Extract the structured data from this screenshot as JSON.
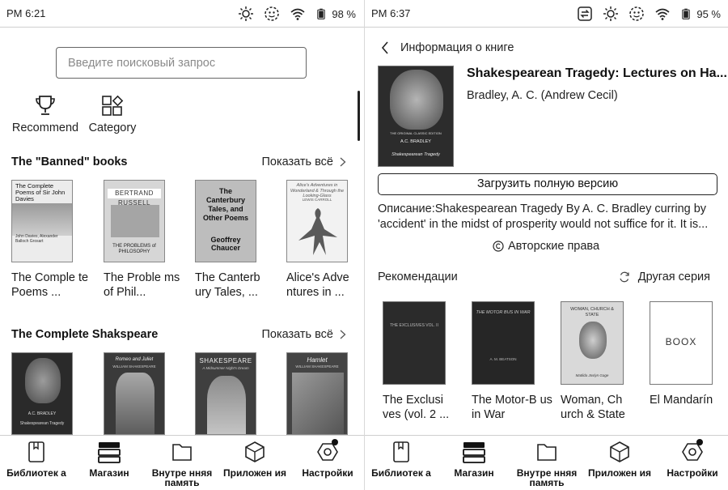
{
  "left": {
    "status": {
      "time": "PM  6:21",
      "battery": "98 %"
    },
    "search": {
      "placeholder": "Введите поисковый запрос"
    },
    "categories": [
      {
        "label": "Recommend",
        "icon": "trophy-icon"
      },
      {
        "label": "Category",
        "icon": "category-grid-icon"
      }
    ],
    "sections": [
      {
        "title": "The \"Banned\" books",
        "show_all": "Показать всё",
        "books": [
          {
            "title": "The Comple te Poems ...",
            "cover_text": "The Complete Poems of Sir John Davies",
            "cover_sub": "John Davies, Alexander Balloch Grosart"
          },
          {
            "title": "The Proble ms of Phil...",
            "cover_text": "BERTRAND RUSSELL",
            "cover_sub": "THE PROBLEMS of PHILOSOPHY"
          },
          {
            "title": "The Canterb ury Tales, ...",
            "cover_text": "The Canterbury Tales, and Other Poems",
            "cover_sub": "Geoffrey Chaucer"
          },
          {
            "title": "Alice's Adve ntures in ...",
            "cover_text": "Alice's Adventures in Wonderland & Through the Looking-Glass",
            "cover_sub": "LEWIS CARROLL"
          }
        ]
      },
      {
        "title": "The Complete Shakspeare",
        "show_all": "Показать всё",
        "books": [
          {
            "title": "",
            "cover_text": "A.C. BRADLEY",
            "cover_sub": "Shakespearean Tragedy"
          },
          {
            "title": "",
            "cover_text": "Romeo and Juliet",
            "cover_sub": "WILLIAM SHAKESPEARE"
          },
          {
            "title": "",
            "cover_text": "SHAKESPEARE",
            "cover_sub": "A Midsummer Night's Dream"
          },
          {
            "title": "",
            "cover_text": "Hamlet",
            "cover_sub": "WILLIAM SHAKESPEARE"
          }
        ]
      }
    ]
  },
  "right": {
    "status": {
      "time": "PM  6:37",
      "battery": "95 %"
    },
    "header": {
      "back_title": "Информация о книге"
    },
    "book": {
      "title": "Shakespearean Tragedy: Lectures on Ha...",
      "author": "Bradley, A. C. (Andrew Cecil)",
      "cover_top": "THE ORIGINAL CLASSIC EDITION",
      "cover_name": "A.C. BRADLEY",
      "cover_sub": "Shakespearean Tragedy"
    },
    "download_label": "Загрузить полную версию",
    "description": "Описание:Shakespearean Tragedy By A. C. Bradley curring by 'accident' in the midst of prosperity would not suffice for it. It is...",
    "copyright_label": "Авторские права",
    "recommendations": {
      "title": "Рекомендации",
      "other_series": "Другая серия",
      "books": [
        {
          "title": "The Exclusi ves (vol. 2 ...",
          "cover_text": "THE EXCLUSIVES VOL. II"
        },
        {
          "title": "The Motor-B us in War",
          "cover_text": "THE MOTOR BUS IN WAR",
          "cover_sub": "A. M. BEATSON"
        },
        {
          "title": "Woman, Ch urch & State",
          "cover_text": "WOMAN, CHURCH & STATE",
          "cover_sub": "Matilda Joslyn Gage"
        },
        {
          "title": "El Mandarín",
          "cover_text": "BOOX"
        }
      ]
    }
  },
  "nav": {
    "items": [
      {
        "label": "Библиотек а",
        "icon": "library-icon"
      },
      {
        "label": "Магазин",
        "icon": "store-icon"
      },
      {
        "label": "Внутре нняя память",
        "icon": "folder-icon"
      },
      {
        "label": "Приложен ия",
        "icon": "apps-icon"
      },
      {
        "label": "Настройки",
        "icon": "settings-icon"
      }
    ]
  },
  "colors": {
    "text": "#1a1a1a",
    "border": "#666666",
    "cover_dark": "#2c2c2c"
  }
}
